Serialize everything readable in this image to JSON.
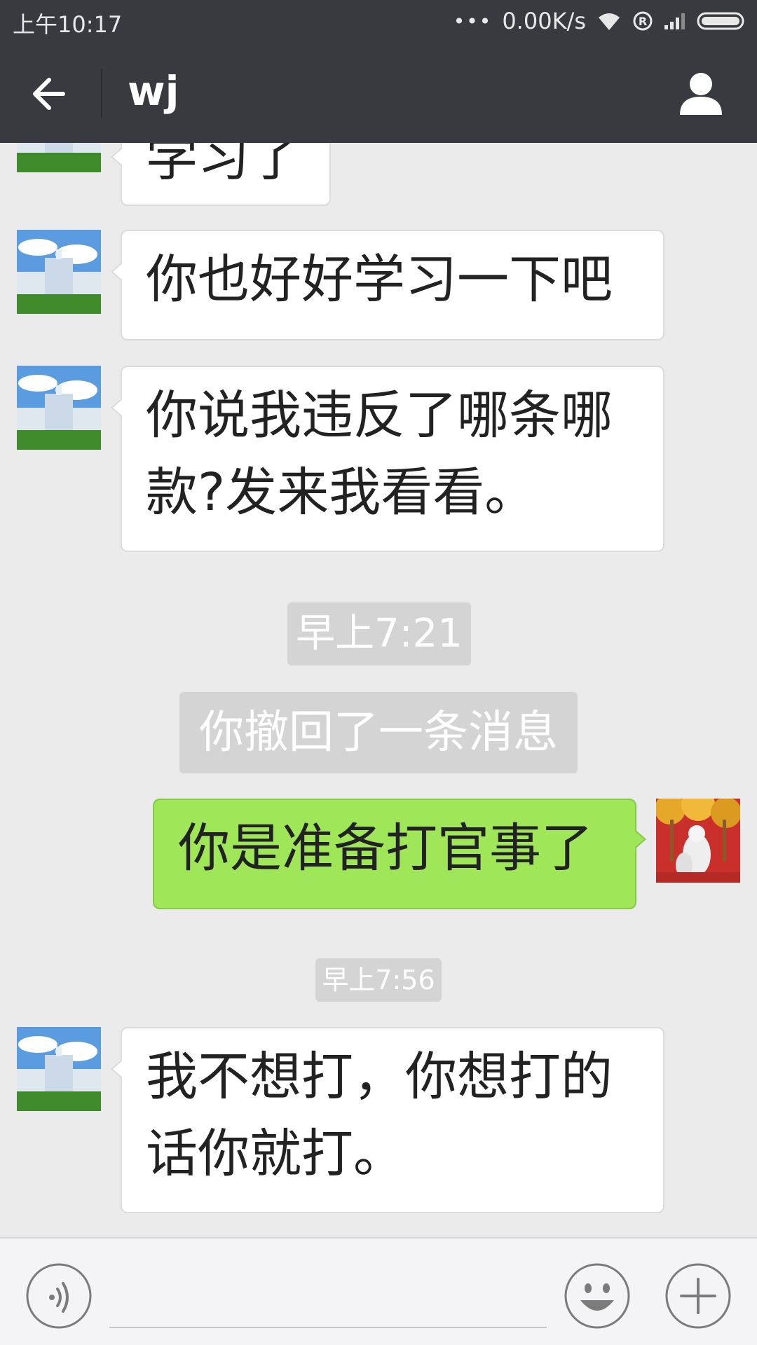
{
  "status_bar": {
    "time": "上午10:17",
    "dots": "•••",
    "speed": "0.00K/s"
  },
  "header": {
    "title": "wj",
    "back_icon": "back-arrow-icon",
    "profile_icon": "person-icon"
  },
  "messages": [
    {
      "side": "left",
      "text_lines": [
        "学习了"
      ]
    },
    {
      "side": "left",
      "text_lines": [
        "你也好好学习一下吧"
      ]
    },
    {
      "side": "left",
      "text_lines": [
        "你说我违反了哪条哪",
        "款?发来我看看。"
      ]
    },
    {
      "type": "time",
      "text": "早上7:21"
    },
    {
      "type": "system",
      "text": "你撤回了一条消息"
    },
    {
      "side": "right",
      "text_lines": [
        "你是准备打官事了"
      ]
    },
    {
      "type": "time",
      "text": "早上7:56"
    },
    {
      "side": "left",
      "text_lines": [
        "我不想打，你想打的",
        "话你就打。"
      ]
    }
  ],
  "input_bar": {
    "voice_icon": "voice-icon",
    "emoji_icon": "emoji-icon",
    "plus_icon": "plus-icon"
  },
  "colors": {
    "header_bg": "#393a3f",
    "chat_bg": "#ebebeb",
    "sent_bubble": "#9fe658",
    "received_bubble": "#ffffff"
  }
}
